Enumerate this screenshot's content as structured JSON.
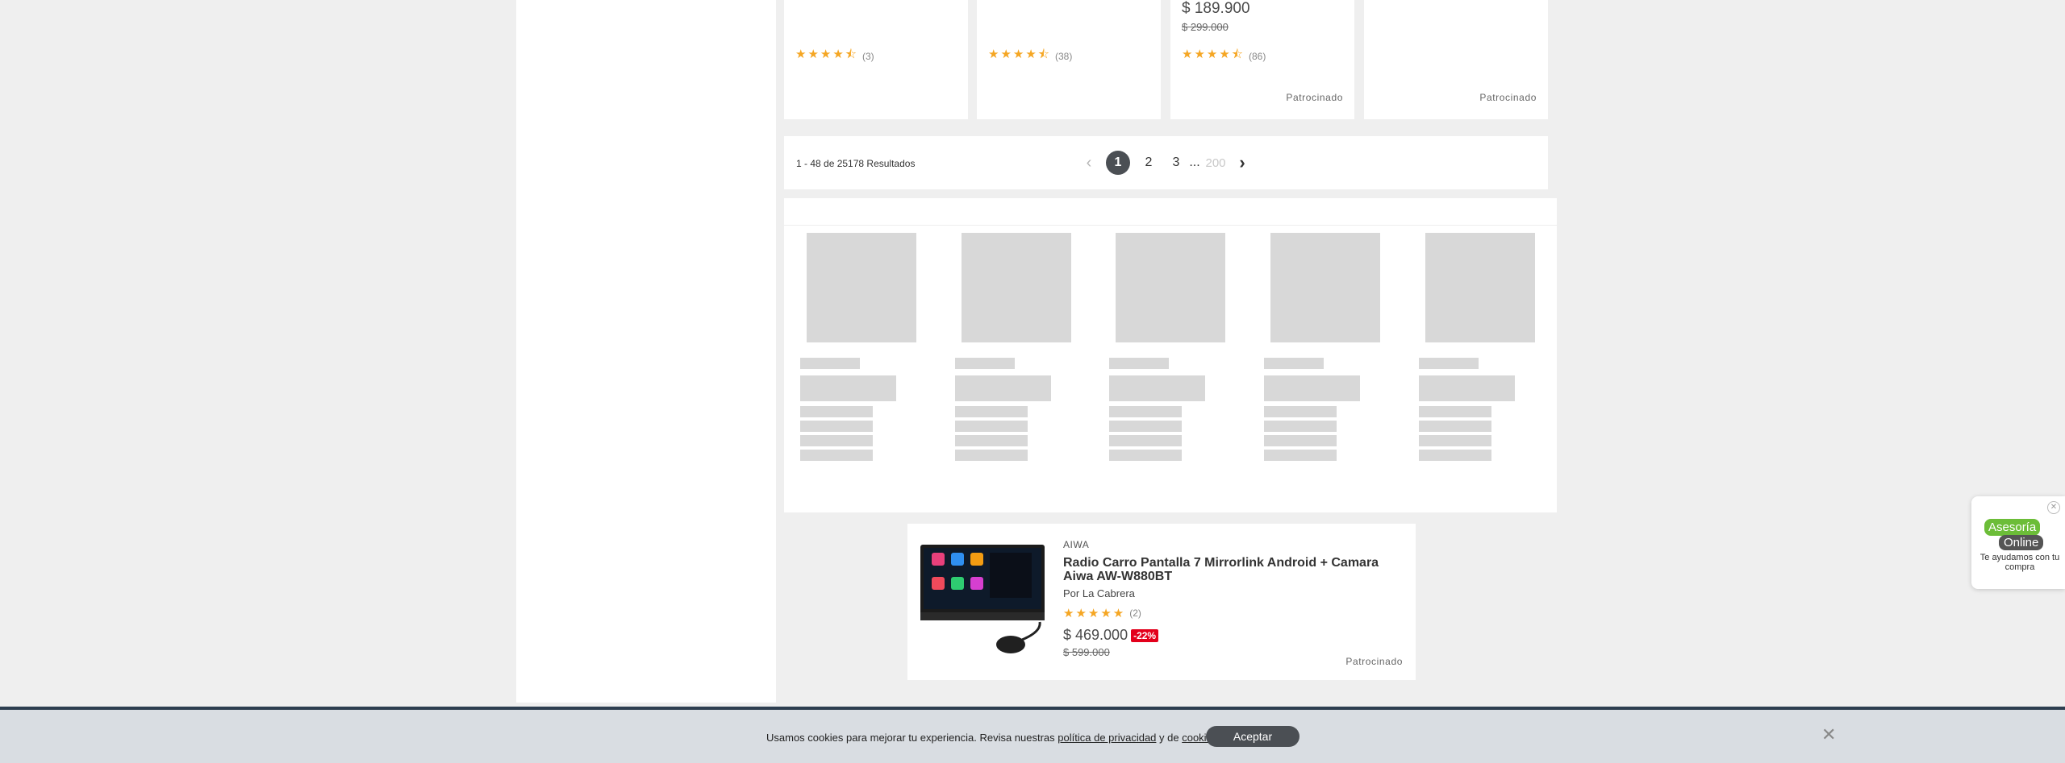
{
  "cards": [
    {
      "price": "",
      "old_price": "",
      "stars": "★★★★⯪",
      "rating_count": "(3)",
      "sponsored": ""
    },
    {
      "price": "",
      "old_price": "",
      "stars": "★★★★⯪",
      "rating_count": "(38)",
      "sponsored": ""
    },
    {
      "price": "$ 189.900",
      "old_price": "$ 299.000",
      "stars": "★★★★⯪",
      "rating_count": "(86)",
      "sponsored": "Patrocinado"
    },
    {
      "price": "",
      "old_price": "",
      "stars": "",
      "rating_count": "",
      "sponsored": "Patrocinado"
    }
  ],
  "pagination": {
    "results_text": "1 - 48 de 25178 Resultados",
    "prev_icon": "chevron-left-icon",
    "pages": [
      "1",
      "2",
      "3"
    ],
    "ellipsis": "...",
    "last_page": "200",
    "next_icon": "chevron-right-icon"
  },
  "product": {
    "brand": "AIWA",
    "title": "Radio Carro Pantalla 7 Mirrorlink Android + Camara Aiwa AW-W880BT",
    "seller": "Por La Cabrera",
    "stars": "★★★★★",
    "rating_count": "(2)",
    "price": "$ 469.000",
    "discount": "-22%",
    "old_price": "$ 599.000",
    "sponsored": "Patrocinado"
  },
  "chat_widget": {
    "bubble1": "Asesoría",
    "bubble2": "Online",
    "help_text": "Te ayudamos con tu compra",
    "close_icon": "close-icon"
  },
  "cookie_banner": {
    "text_before": "Usamos cookies para mejorar tu experiencia. Revisa nuestras ",
    "privacy_link": "política de privacidad",
    "text_middle": " y de ",
    "cookies_link": "cookies",
    "text_after": ".",
    "accept_label": "Aceptar",
    "close_icon": "close-icon"
  },
  "colors": {
    "accent_dark": "#4b4f54",
    "star": "#f5a623",
    "discount": "#e3001b",
    "chat_green": "#6cbd38"
  }
}
